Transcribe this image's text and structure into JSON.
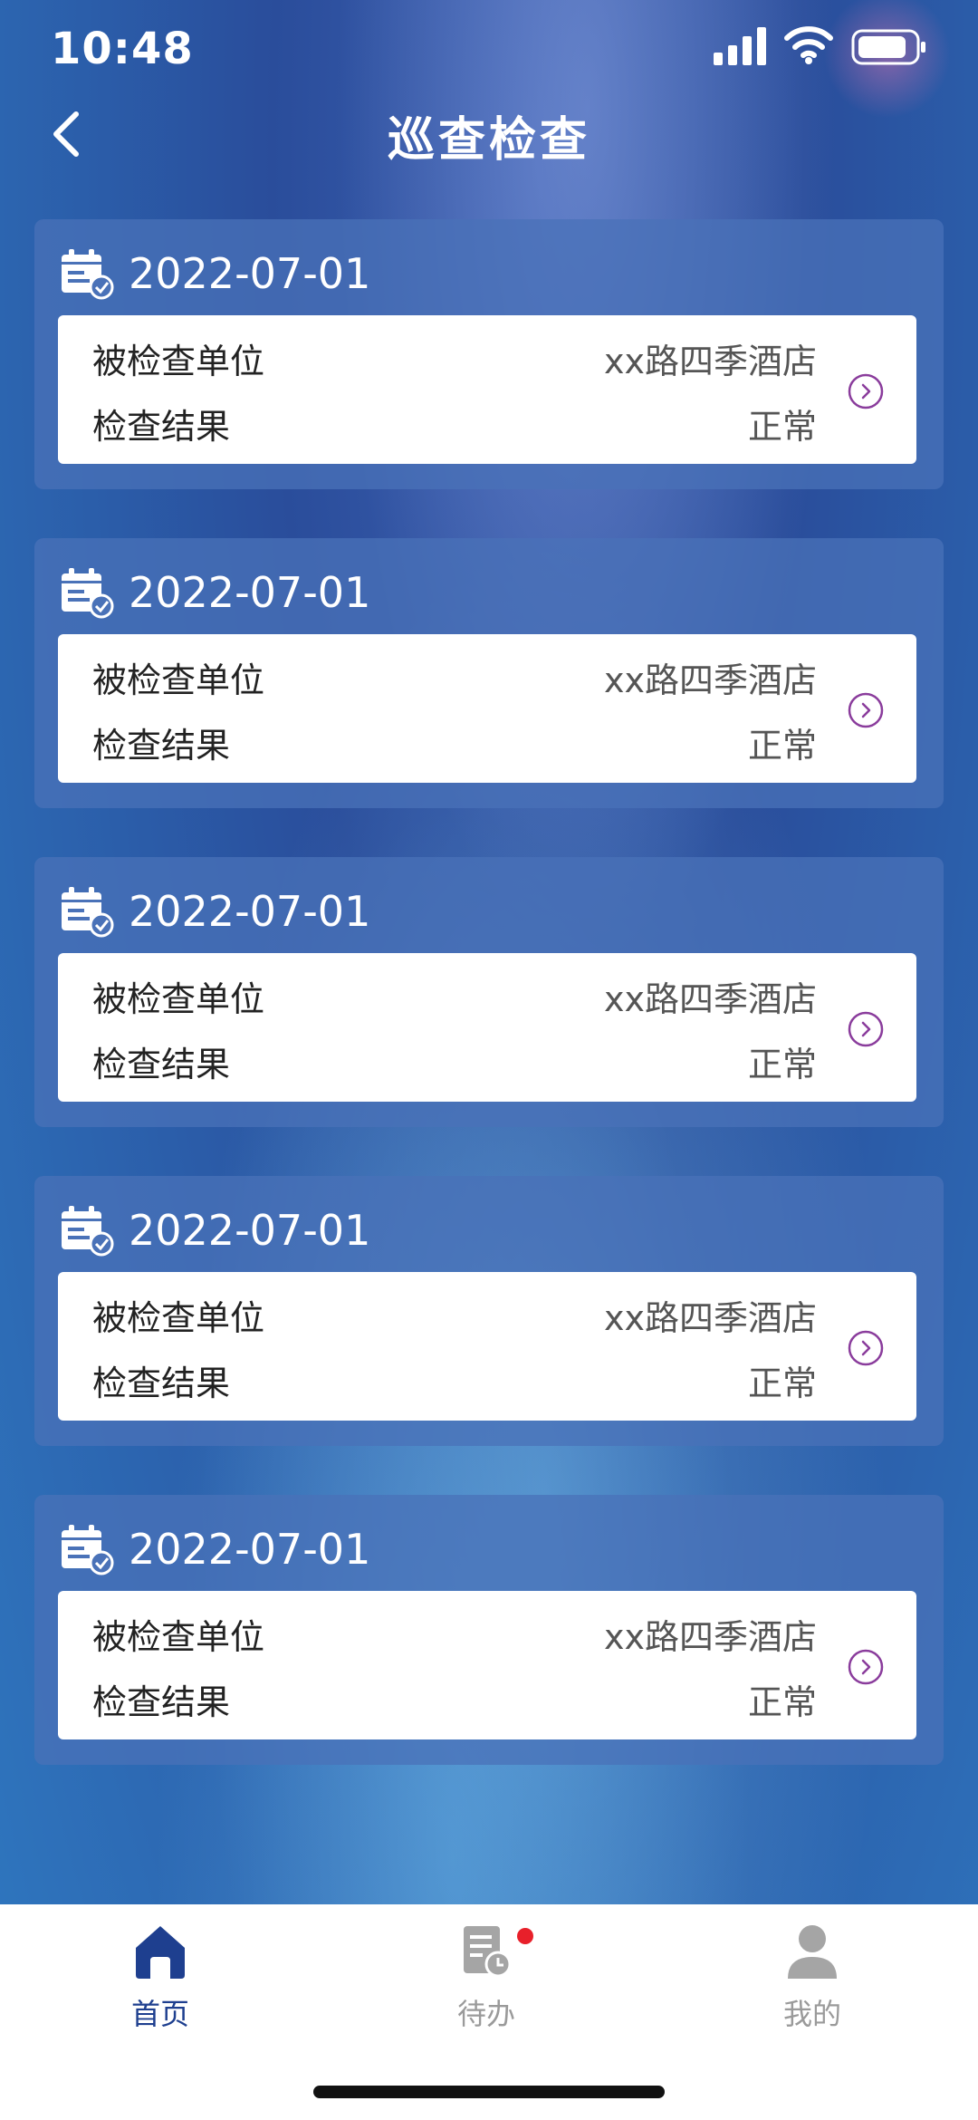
{
  "status_bar": {
    "time": "10:48"
  },
  "header": {
    "title": "巡查检查"
  },
  "records": [
    {
      "date": "2022-07-01",
      "unit_label": "被检查单位",
      "unit_value": "xx路四季酒店",
      "result_label": "检查结果",
      "result_value": "正常"
    },
    {
      "date": "2022-07-01",
      "unit_label": "被检查单位",
      "unit_value": "xx路四季酒店",
      "result_label": "检查结果",
      "result_value": "正常"
    },
    {
      "date": "2022-07-01",
      "unit_label": "被检查单位",
      "unit_value": "xx路四季酒店",
      "result_label": "检查结果",
      "result_value": "正常"
    },
    {
      "date": "2022-07-01",
      "unit_label": "被检查单位",
      "unit_value": "xx路四季酒店",
      "result_label": "检查结果",
      "result_value": "正常"
    },
    {
      "date": "2022-07-01",
      "unit_label": "被检查单位",
      "unit_value": "xx路四季酒店",
      "result_label": "检查结果",
      "result_value": "正常"
    }
  ],
  "tabbar": {
    "home": {
      "label": "首页",
      "icon": "home-icon"
    },
    "todo": {
      "label": "待办",
      "icon": "todo-document-icon",
      "has_badge": true
    },
    "me": {
      "label": "我的",
      "icon": "user-icon"
    }
  },
  "colors": {
    "accent": "#1e3f8f",
    "badge": "#e8202a",
    "arrow": "#8a3c9c"
  }
}
